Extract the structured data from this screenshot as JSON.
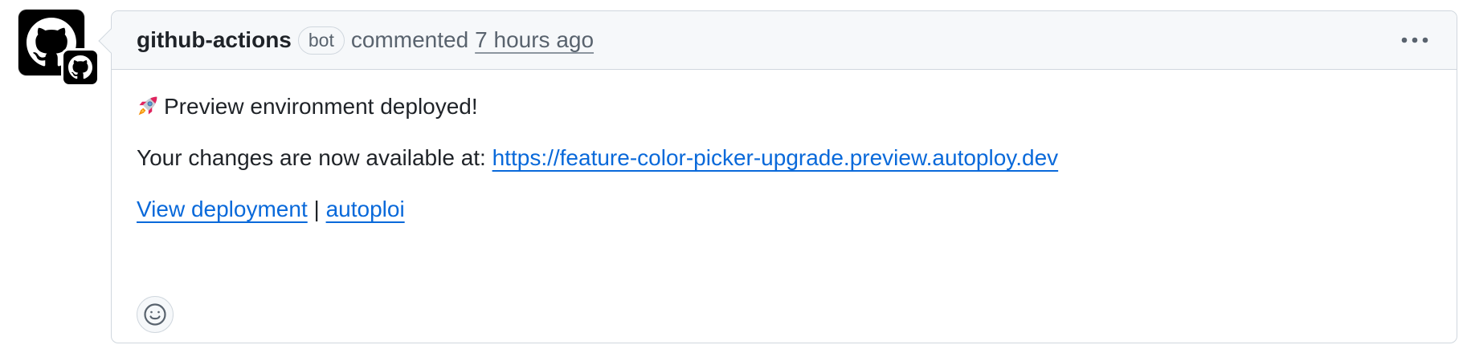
{
  "comment": {
    "author": "github-actions",
    "badge": "bot",
    "action": "commented",
    "time_ago": "7 hours ago",
    "more_icon": "kebab-horizontal-icon"
  },
  "avatar": {
    "icon": "github-octocat-icon",
    "badge_icon": "github-octocat-icon",
    "color": "#000000"
  },
  "body": {
    "emoji": "rocket-emoji",
    "line1": "Preview environment deployed!",
    "line2_prefix": "Your changes are now available at: ",
    "line2_link": "https://feature-color-picker-upgrade.preview.autoploy.dev",
    "line3_link1": "View deployment",
    "line3_separator": " | ",
    "line3_link2": "autoploi"
  },
  "reactions": {
    "icon": "smiley-icon"
  },
  "colors": {
    "link": "#0969da",
    "border": "#d0d7de",
    "header_bg": "#f6f8fa",
    "muted": "#59636e"
  }
}
